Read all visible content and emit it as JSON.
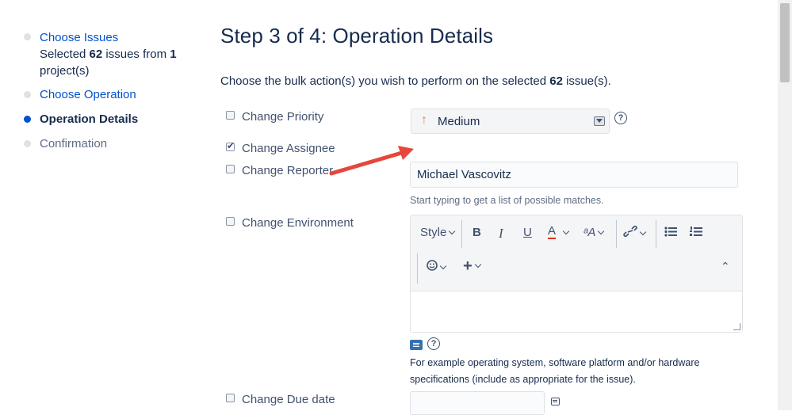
{
  "sidebar": {
    "steps": [
      {
        "label": "Choose Issues",
        "state": "link"
      },
      {
        "label": "Choose Operation",
        "state": "link"
      },
      {
        "label": "Operation Details",
        "state": "current"
      },
      {
        "label": "Confirmation",
        "state": "pending"
      }
    ],
    "summary": {
      "prefix": "Selected",
      "issue_count": "62",
      "middle": "issues from",
      "project_count": "1",
      "suffix": "project(s)"
    }
  },
  "main": {
    "title": "Step 3 of 4: Operation Details",
    "intro": {
      "prefix": "Choose the bulk action(s) you wish to perform on the selected",
      "count": "62",
      "suffix": "issue(s)."
    },
    "options": [
      {
        "label": "Change Priority",
        "checked": false
      },
      {
        "label": "Change Assignee",
        "checked": true
      },
      {
        "label": "Change Reporter",
        "checked": false
      },
      {
        "label": "Change Environment",
        "checked": false
      },
      {
        "label": "Change Due date",
        "checked": false
      }
    ],
    "priority": {
      "value": "Medium",
      "icon": "arrow-up-icon",
      "color": "#ff7452"
    },
    "assignee": {
      "value": "Michael Vascovitz",
      "hint": "Start typing to get a list of possible matches."
    },
    "editor": {
      "toolbar": {
        "style": "Style",
        "bold": "B",
        "italic": "I",
        "underline": "U",
        "text_color": "A",
        "more_formatting": "ᵃA",
        "insert": "+",
        "collapse": "⌃"
      },
      "description": "For example operating system, software platform and/or hardware specifications (include as appropriate for the issue)."
    },
    "help_glyph": "?"
  },
  "colors": {
    "accent": "#0052cc",
    "annotation_arrow": "#e5473d"
  }
}
